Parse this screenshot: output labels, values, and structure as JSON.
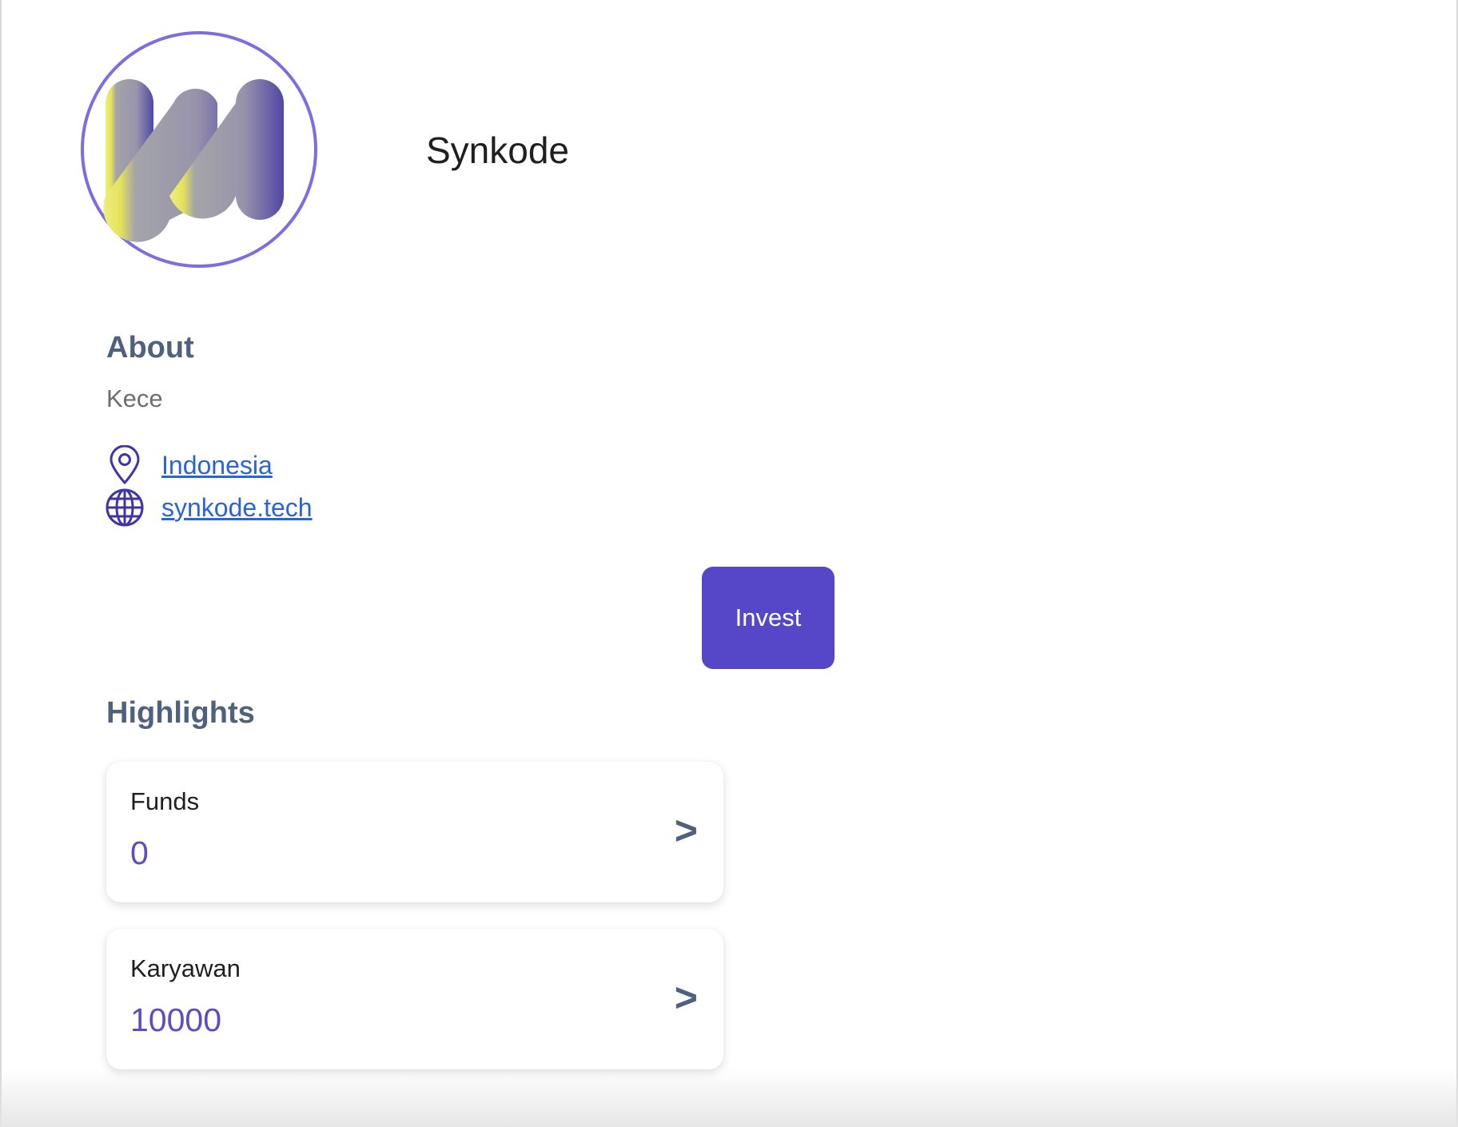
{
  "company": {
    "name": "Synkode",
    "logo_icon": "synkode-m-logo"
  },
  "about": {
    "heading": "About",
    "description": "Kece"
  },
  "info": {
    "location": {
      "icon": "map-pin-icon",
      "label": "Indonesia"
    },
    "website": {
      "icon": "globe-icon",
      "label": "synkode.tech"
    }
  },
  "actions": {
    "invest_label": "Invest"
  },
  "highlights": {
    "heading": "Highlights",
    "items": [
      {
        "label": "Funds",
        "value": "0",
        "chevron": ">"
      },
      {
        "label": "Karyawan",
        "value": "10000",
        "chevron": ">"
      }
    ]
  },
  "colors": {
    "accent": "#5647c8",
    "ring": "#7b6ee0",
    "value": "#5b4dc4",
    "heading": "#4f617c",
    "link": "#2b63d9"
  }
}
